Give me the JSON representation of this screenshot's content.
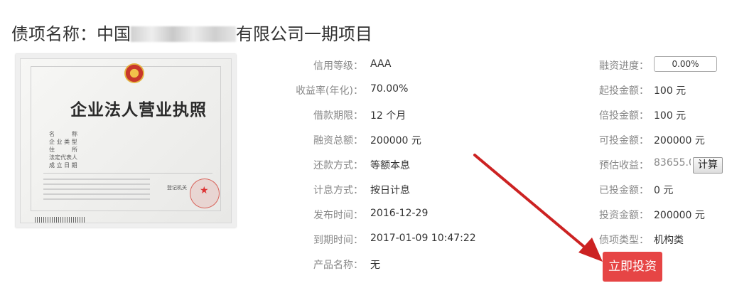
{
  "title": {
    "prefix": "债项名称：中国",
    "suffix": "有限公司一期项目"
  },
  "license": {
    "heading": "企业法人营业执照",
    "fields": [
      "名　　　称",
      "企 业 类 型",
      "住　　　所",
      "法定代表人",
      "成 立 日 期"
    ],
    "registry": "登记机关"
  },
  "left_column": [
    {
      "label": "信用等级：",
      "value": "AAA"
    },
    {
      "label": "收益率(年化)：",
      "value": "70.00%"
    },
    {
      "label": "借款期限：",
      "value": "12  个月"
    },
    {
      "label": "融资总额：",
      "value": "200000  元"
    },
    {
      "label": "还款方式：",
      "value": "等额本息"
    },
    {
      "label": "计息方式：",
      "value": "按日计息"
    },
    {
      "label": "发布时间：",
      "value": "2016-12-29"
    },
    {
      "label": "到期时间：",
      "value": "2017-01-09 10:47:22"
    },
    {
      "label": "产品名称：",
      "value": "无"
    }
  ],
  "right_column": {
    "progress": {
      "label": "融资进度：",
      "value": "0.00%"
    },
    "min_invest": {
      "label": "起投金额：",
      "value": "100  元"
    },
    "multiple": {
      "label": "倍投金额：",
      "value": "100  元"
    },
    "available": {
      "label": "可投金额：",
      "value": "200000  元"
    },
    "estimate": {
      "label": "预估收益：",
      "value": "83655.00",
      "button": "计算"
    },
    "invested": {
      "label": "已投金额：",
      "value": "0  元"
    },
    "invest_amount": {
      "label": "投资金额：",
      "value": "200000  元"
    },
    "type": {
      "label": "债项类型：",
      "value": "机构类"
    }
  },
  "invest_button": "立即投资",
  "colors": {
    "accent": "#e64545",
    "arrow": "#cc2222"
  }
}
